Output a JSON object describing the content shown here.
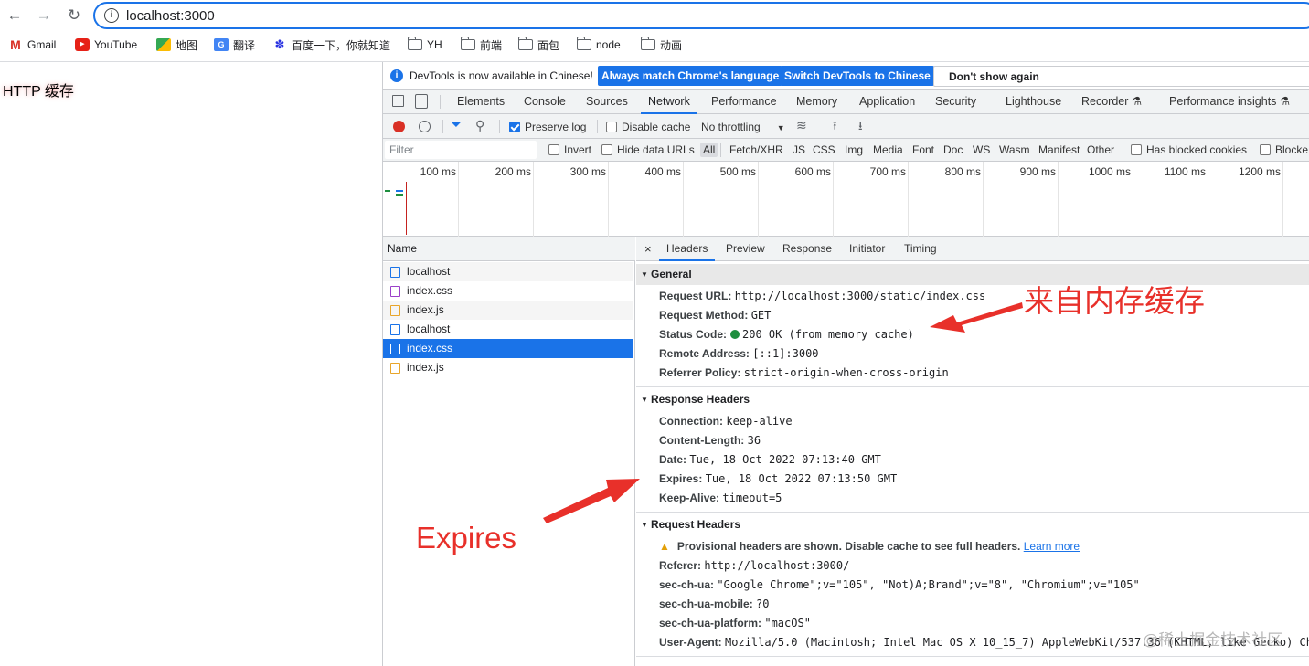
{
  "browser": {
    "url": "localhost:3000",
    "bookmarks": [
      {
        "label": "Gmail",
        "icon": "gmail-icon"
      },
      {
        "label": "YouTube",
        "icon": "youtube-icon"
      },
      {
        "label": "地图",
        "icon": "maps-icon"
      },
      {
        "label": "翻译",
        "icon": "translate-icon"
      },
      {
        "label": "百度一下，你就知道",
        "icon": "baidu-icon"
      },
      {
        "label": "YH",
        "icon": "folder-icon"
      },
      {
        "label": "前端",
        "icon": "folder-icon"
      },
      {
        "label": "面包",
        "icon": "folder-icon"
      },
      {
        "label": "node",
        "icon": "folder-icon"
      },
      {
        "label": "动画",
        "icon": "folder-icon"
      }
    ]
  },
  "page": {
    "heading": "HTTP 缓存"
  },
  "devtools": {
    "infobar": {
      "message": "DevTools is now available in Chinese!",
      "btn_match": "Always match Chrome's language",
      "btn_switch": "Switch DevTools to Chinese",
      "btn_dismiss": "Don't show again"
    },
    "tabs": [
      "Elements",
      "Console",
      "Sources",
      "Network",
      "Performance",
      "Memory",
      "Application",
      "Security",
      "Lighthouse",
      "Recorder ⚗",
      "Performance insights ⚗"
    ],
    "selected_tab": "Network",
    "toolbar": {
      "preserve_log": "Preserve log",
      "disable_cache": "Disable cache",
      "throttling": "No throttling"
    },
    "filter": {
      "placeholder": "Filter",
      "invert": "Invert",
      "hide_data_urls": "Hide data URLs",
      "types": [
        "All",
        "Fetch/XHR",
        "JS",
        "CSS",
        "Img",
        "Media",
        "Font",
        "Doc",
        "WS",
        "Wasm",
        "Manifest",
        "Other"
      ],
      "has_blocked_cookies": "Has blocked cookies",
      "blocked": "Blocke"
    },
    "timeline_ticks": [
      "100 ms",
      "200 ms",
      "300 ms",
      "400 ms",
      "500 ms",
      "600 ms",
      "700 ms",
      "800 ms",
      "900 ms",
      "1000 ms",
      "1100 ms",
      "1200 ms"
    ],
    "name_header": "Name",
    "requests": [
      {
        "name": "localhost",
        "type": "doc"
      },
      {
        "name": "index.css",
        "type": "css"
      },
      {
        "name": "index.js",
        "type": "js"
      },
      {
        "name": "localhost",
        "type": "doc"
      },
      {
        "name": "index.css",
        "type": "css",
        "selected": true
      },
      {
        "name": "index.js",
        "type": "js"
      }
    ],
    "detail_tabs": [
      "Headers",
      "Preview",
      "Response",
      "Initiator",
      "Timing"
    ],
    "general": {
      "title": "General",
      "rows": [
        {
          "k": "Request URL:",
          "v": "http://localhost:3000/static/index.css"
        },
        {
          "k": "Request Method:",
          "v": "GET"
        },
        {
          "k": "Status Code:",
          "v": "200 OK (from memory cache)"
        },
        {
          "k": "Remote Address:",
          "v": "[::1]:3000"
        },
        {
          "k": "Referrer Policy:",
          "v": "strict-origin-when-cross-origin"
        }
      ]
    },
    "response_headers": {
      "title": "Response Headers",
      "rows": [
        {
          "k": "Connection:",
          "v": "keep-alive"
        },
        {
          "k": "Content-Length:",
          "v": "36"
        },
        {
          "k": "Date:",
          "v": "Tue, 18 Oct 2022 07:13:40 GMT"
        },
        {
          "k": "Expires:",
          "v": "Tue, 18 Oct 2022 07:13:50 GMT"
        },
        {
          "k": "Keep-Alive:",
          "v": "timeout=5"
        }
      ]
    },
    "request_headers": {
      "title": "Request Headers",
      "warning": "Provisional headers are shown. Disable cache to see full headers.",
      "learn_more": "Learn more",
      "rows": [
        {
          "k": "Referer:",
          "v": "http://localhost:3000/"
        },
        {
          "k": "sec-ch-ua:",
          "v": "\"Google Chrome\";v=\"105\", \"Not)A;Brand\";v=\"8\", \"Chromium\";v=\"105\""
        },
        {
          "k": "sec-ch-ua-mobile:",
          "v": "?0"
        },
        {
          "k": "sec-ch-ua-platform:",
          "v": "\"macOS\""
        },
        {
          "k": "User-Agent:",
          "v": "Mozilla/5.0 (Macintosh; Intel Mac OS X 10_15_7) AppleWebKit/537.36 (KHTML, like Gecko) Ch"
        }
      ]
    }
  },
  "annotations": {
    "memory_cache": "来自内存缓存",
    "expires": "Expires",
    "watermark": "@稀土掘金技术社区"
  },
  "colors": {
    "accent": "#1a73e8",
    "annotation": "#e8302a",
    "status_ok": "#1e8e3e"
  }
}
